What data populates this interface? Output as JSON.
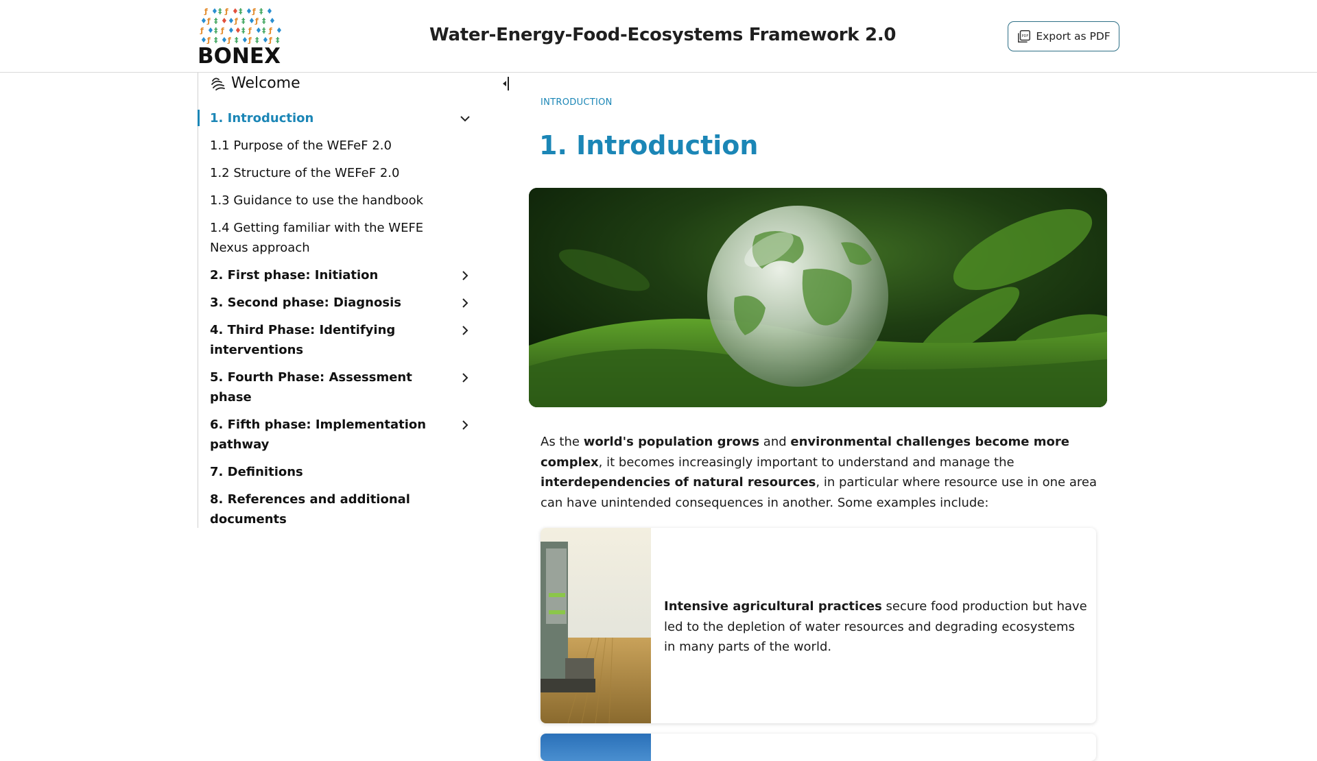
{
  "header": {
    "logo_text": "BONEX",
    "title": "Water-Energy-Food-Ecosystems Framework 2.0",
    "export_label": "Export as PDF",
    "export_icon": "pdf-icon"
  },
  "sidebar": {
    "welcome_label": "Welcome",
    "welcome_icon": "waves-hand-icon",
    "items": [
      {
        "label": "1.  Introduction",
        "kind": "chapter",
        "active": true,
        "chevron": "down"
      },
      {
        "label": "1.1  Purpose of the WEFeF 2.0",
        "kind": "sub"
      },
      {
        "label": "1.2  Structure of the WEFeF 2.0",
        "kind": "sub"
      },
      {
        "label": "1.3  Guidance to use the handbook",
        "kind": "sub"
      },
      {
        "label": "1.4  Getting familiar with the WEFE Nexus approach",
        "kind": "sub"
      },
      {
        "label": "2.  First phase: Initiation",
        "kind": "chapter",
        "chevron": "right"
      },
      {
        "label": "3.  Second phase: Diagnosis",
        "kind": "chapter",
        "chevron": "right"
      },
      {
        "label": "4.  Third Phase: Identifying interventions",
        "kind": "chapter",
        "chevron": "right"
      },
      {
        "label": "5.  Fourth Phase: Assessment phase",
        "kind": "chapter",
        "chevron": "right"
      },
      {
        "label": "6.  Fifth phase: Implementation pathway",
        "kind": "chapter",
        "chevron": "right"
      },
      {
        "label": "7.  Definitions",
        "kind": "chapter"
      },
      {
        "label": "8.  References and additional documents",
        "kind": "chapter"
      }
    ]
  },
  "main": {
    "eyebrow": "INTRODUCTION",
    "title": "1. Introduction",
    "intro": {
      "t1": "As the ",
      "b1": "world's population grows",
      "t2": " and ",
      "b2": "environmental challenges become more complex",
      "t3": ", it becomes increasingly important to understand and manage the ",
      "b3": "interdependencies of natural resources",
      "t4": ", in particular where resource use in one area can have unintended consequences in another. Some examples include:"
    },
    "cards": [
      {
        "bold": "Intensive agricultural practices",
        "text": " secure food production but have led to the depletion of water resources and degrading ecosystems in many parts of the world."
      }
    ]
  },
  "colors": {
    "accent": "#1b86b6",
    "export_border": "#2d6f86"
  }
}
